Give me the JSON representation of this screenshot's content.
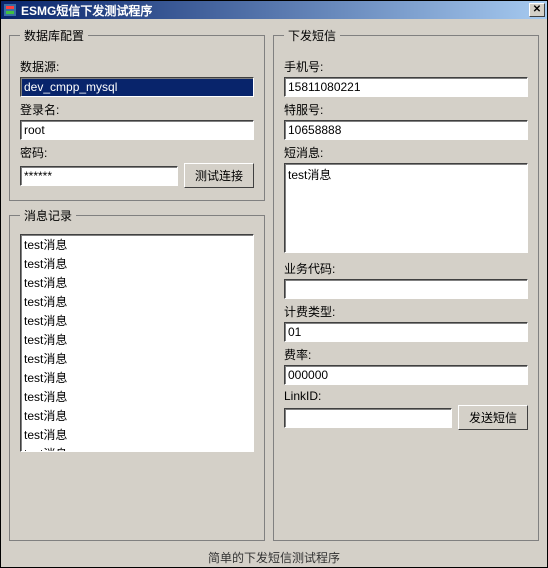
{
  "window": {
    "title": "ESMG短信下发测试程序",
    "close_glyph": "✕"
  },
  "db": {
    "legend": "数据库配置",
    "datasource_label": "数据源:",
    "datasource_value": "dev_cmpp_mysql",
    "login_label": "登录名:",
    "login_value": "root",
    "password_label": "密码:",
    "password_value": "******",
    "test_btn": "测试连接"
  },
  "log": {
    "legend": "消息记录",
    "items": [
      "test消息",
      "test消息",
      "test消息",
      "test消息",
      "test消息",
      "test消息",
      "test消息",
      "test消息",
      "test消息",
      "test消息",
      "test消息",
      "test消息"
    ]
  },
  "send": {
    "legend": "下发短信",
    "phone_label": "手机号:",
    "phone_value": "15811080221",
    "spnum_label": "特服号:",
    "spnum_value": "10658888",
    "msg_label": "短消息:",
    "msg_value": "test消息",
    "biz_label": "业务代码:",
    "biz_value": "",
    "fee_type_label": "计费类型:",
    "fee_type_value": "01",
    "rate_label": "费率:",
    "rate_value": "000000",
    "linkid_label": "LinkID:",
    "linkid_value": "",
    "send_btn": "发送短信"
  },
  "footer": "简单的下发短信测试程序"
}
